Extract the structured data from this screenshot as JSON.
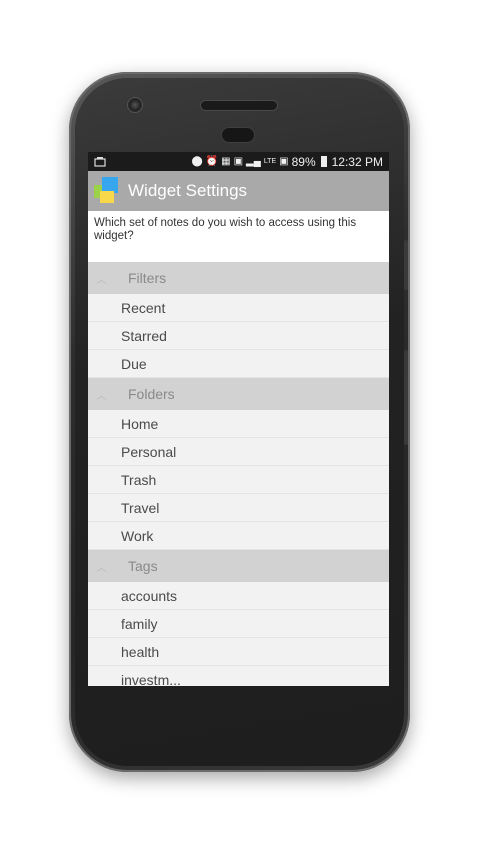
{
  "status_bar": {
    "battery_percent": "89%",
    "time": "12:32 PM",
    "network": "LTE"
  },
  "app_bar": {
    "title": "Widget Settings"
  },
  "prompt": "Which set of notes do you wish to access using this widget?",
  "sections": [
    {
      "label": "Filters",
      "items": [
        "Recent",
        "Starred",
        "Due"
      ]
    },
    {
      "label": "Folders",
      "items": [
        "Home",
        "Personal",
        "Trash",
        "Travel",
        "Work"
      ]
    },
    {
      "label": "Tags",
      "items": [
        "accounts",
        "family",
        "health",
        "investm..."
      ]
    }
  ]
}
